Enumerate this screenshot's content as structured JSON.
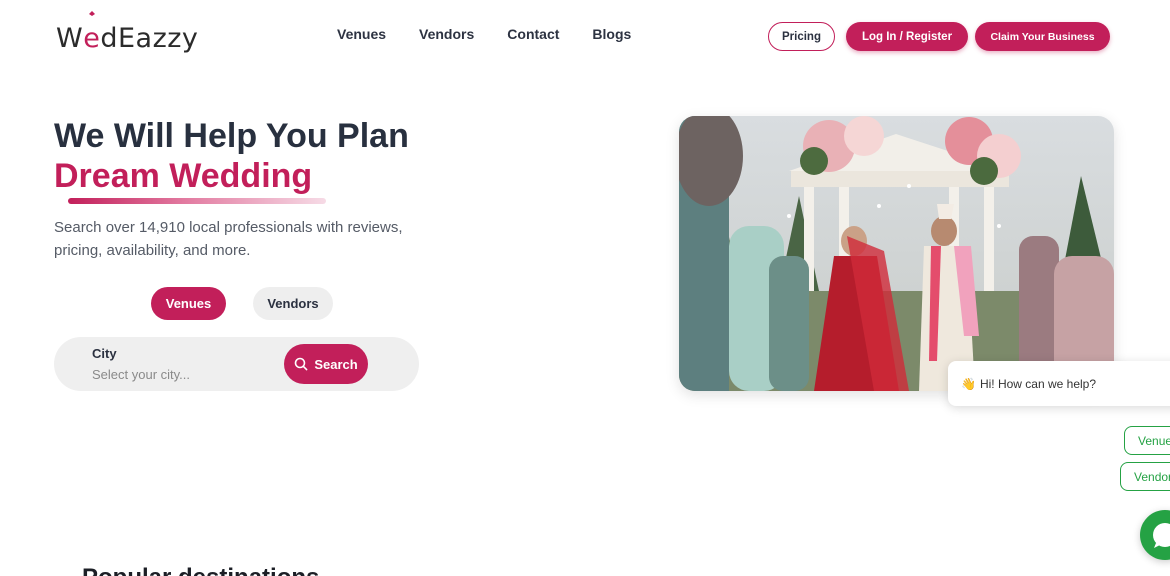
{
  "brand": {
    "logo_text_prefix": "W",
    "logo_ring_letter": "e",
    "logo_text_suffix": "dEazzy",
    "accent": "#c21f5a"
  },
  "nav": {
    "items": [
      {
        "label": "Venues"
      },
      {
        "label": "Vendors"
      },
      {
        "label": "Contact"
      },
      {
        "label": "Blogs"
      }
    ],
    "pricing_label": "Pricing",
    "login_label": "Log In / Register",
    "claim_label": "Claim Your Business"
  },
  "hero": {
    "title_line1": "We Will Help You Plan",
    "title_line2": "Dream Wedding",
    "subtitle": "Search over 14,910 local professionals with reviews, pricing, availability, and more."
  },
  "search": {
    "tabs": [
      {
        "label": "Venues",
        "active": true
      },
      {
        "label": "Vendors",
        "active": false
      }
    ],
    "city_label": "City",
    "city_placeholder": "Select your city...",
    "button_label": "Search"
  },
  "chat": {
    "greeting": "Hi! How can we help?",
    "quick_venues": "Venues",
    "quick_vendors": "Vendors",
    "color": "#25a244"
  },
  "section": {
    "title": "Popular destinations"
  }
}
